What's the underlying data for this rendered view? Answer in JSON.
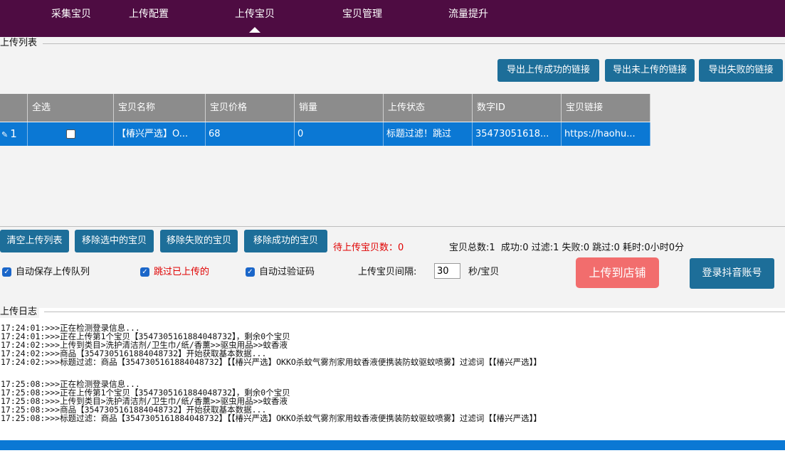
{
  "nav": {
    "items": [
      "采集宝贝",
      "上传配置",
      "上传宝贝",
      "宝贝管理",
      "流量提升"
    ],
    "active_index": 2
  },
  "upload_list": {
    "title": "上传列表",
    "export_buttons": [
      "导出上传成功的链接",
      "导出未上传的链接",
      "导出失败的链接"
    ],
    "columns": [
      "全选",
      "宝贝名称",
      "宝贝价格",
      "销量",
      "上传状态",
      "数字ID",
      "宝贝链接"
    ],
    "rows": [
      {
        "index": "1",
        "checked": false,
        "name": "【椿兴严选】O...",
        "price": "68",
        "sales": "0",
        "status": "标题过滤！跳过",
        "id": "35473051618...",
        "link": "https://haohu..."
      }
    ]
  },
  "actions": {
    "buttons": [
      "清空上传列表",
      "移除选中的宝贝",
      "移除失败的宝贝",
      "移除成功的宝贝"
    ],
    "pending_label": "待上传宝贝数：0",
    "stats": "宝贝总数:1  成功:0 过滤:1 失败:0 跳过:0 耗时:0小时0分"
  },
  "options": {
    "auto_save": "自动保存上传队列",
    "skip_uploaded": "跳过已上传的",
    "auto_captcha": "自动过验证码",
    "interval_label": "上传宝贝间隔:",
    "interval_value": "30",
    "interval_unit": "秒/宝贝",
    "upload_button": "上传到店铺",
    "login_button": "登录抖音账号"
  },
  "log": {
    "title": "上传日志",
    "lines": [
      "17:24:01:>>>正在检测登录信息...",
      "17:24:01:>>>正在上传第1个宝贝【3547305161884048732】，剩余0个宝贝",
      "17:24:02:>>>上传到类目>洗护清洁剂/卫生巾/纸/香薰>>驱虫用品>>蚊香液",
      "17:24:02:>>>商品【3547305161884048732】开始获取基本数据...",
      "17:24:02:>>>标题过滤：商品【3547305161884048732】【【椿兴严选】OKKO杀蚊气雾剂家用蚊香液便携装防蚊驱蚊喷雾】过滤词【【椿兴严选】】",
      "",
      "17:25:08:>>>正在检测登录信息...",
      "17:25:08:>>>正在上传第1个宝贝【3547305161884048732】，剩余0个宝贝",
      "17:25:08:>>>上传到类目>洗护清洁剂/卫生巾/纸/香薰>>驱虫用品>>蚊香液",
      "17:25:08:>>>商品【3547305161884048732】开始获取基本数据...",
      "17:25:08:>>>标题过滤：商品【3547305161884048732】【【椿兴严选】OKKO杀蚊气雾剂家用蚊香液便携装防蚊驱蚊喷雾】过滤词【【椿兴严选】】"
    ]
  },
  "colors": {
    "nav_bg": "#4e0c42",
    "button_bg": "#1d6e99",
    "selected_row": "#0b78d4",
    "upload_button": "#f26d6d",
    "warning_text": "#e00000"
  }
}
